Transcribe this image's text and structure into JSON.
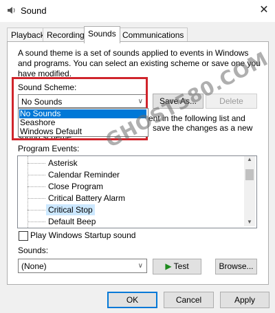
{
  "window": {
    "title": "Sound",
    "close_glyph": "✕",
    "icon": "speaker-icon"
  },
  "tabs": [
    {
      "label": "Playback"
    },
    {
      "label": "Recording"
    },
    {
      "label": "Sounds",
      "active": true
    },
    {
      "label": "Communications"
    }
  ],
  "intro": {
    "line1": "A sound theme is a set of sounds applied to events in Windows",
    "line2": "and programs.  You can select an existing scheme or save one you",
    "line3": "have modified."
  },
  "scheme": {
    "label": "Sound Scheme:",
    "selected": "No Sounds",
    "options": [
      "No Sounds",
      "Seashore",
      "Windows Default"
    ],
    "save_as": "Save As...",
    "delete": "Delete"
  },
  "partial_text": {
    "line1": "ent in the following list and",
    "line2": "save the changes as a new",
    "line3": "sound scheme."
  },
  "program_events": {
    "label": "Program Events:",
    "items": [
      "Asterisk",
      "Calendar Reminder",
      "Close Program",
      "Critical Battery Alarm",
      "Critical Stop",
      "Default Beep"
    ],
    "selected_index": 4
  },
  "startup": {
    "label": "Play Windows Startup sound",
    "checked": false
  },
  "sounds": {
    "label": "Sounds:",
    "selected": "(None)",
    "test": "Test",
    "browse": "Browse..."
  },
  "footer": {
    "ok": "OK",
    "cancel": "Cancel",
    "apply": "Apply"
  },
  "watermark": "GHOST580.COM",
  "colors": {
    "accent": "#0078d7",
    "highlight_box": "#d0242b",
    "selected_row": "#cce8ff"
  }
}
